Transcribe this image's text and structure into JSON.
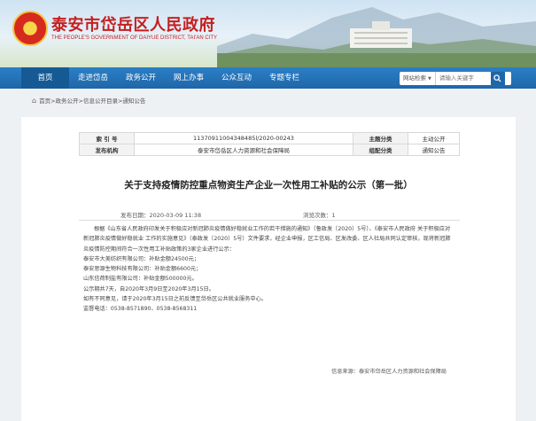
{
  "header": {
    "title": "泰安市岱岳区人民政府",
    "subtitle": "THE PEOPLE'S GOVERNMENT OF DAIYUE DISTRICT, TAI'AN CITY"
  },
  "nav": {
    "items": [
      "首页",
      "走进岱岳",
      "政务公开",
      "网上办事",
      "公众互动",
      "专题专栏"
    ],
    "active_index": 0
  },
  "search": {
    "category": "网站检索",
    "placeholder": "请输入关键字"
  },
  "breadcrumb": "首页>政务公开>信息公开目录>通知公告",
  "meta_table": {
    "index_label": "索 引 号",
    "index_value": "11370911004348485l/2020-00243",
    "category_label": "主题分类",
    "category_value": "主动公开",
    "publisher_label": "发布机构",
    "publisher_value": "泰安市岱岳区人力资源和社会保障局",
    "genre_label": "组配分类",
    "genre_value": "通知公告"
  },
  "article": {
    "title": "关于支持疫情防控重点物资生产企业一次性用工补贴的公示（第一批）",
    "publish_time": "发布日期：2020-03-09 11:38",
    "views": "浏览次数：1",
    "paragraphs": [
      "根据《山东省人民政府印发关于积极应对新冠肺炎疫情做好稳就业工作的若干措施的通知》（鲁政发〔2020〕5号）、《泰安市人民政府 关于积极应对新冠肺炎疫情做好稳就业 工作的实施意见》（泰政发〔2020〕5号）文件要求，经企业申报，区工信局、区发改委、区人社局共同认定审核，现将新冠肺炎疫情防控期间符合一次性用工补贴政策的3家企业进行公示：",
      "泰安市大美纺织有限公司：补贴金额24500元；",
      "泰安思源生物科技有限公司：补贴金额6600元；",
      "山东信荷制盐有限公司：补贴金额500000元。",
      "公示期共7天，自2020年3月9日至2020年3月15日。",
      "如有不同意见，请于2020年3月15日之前反馈至岱岳区公共就业服务中心。",
      "监督电话：0538-8571890、0538-8568311"
    ],
    "source": "信息来源：泰安市岱岳区人力资源和社会保障局"
  }
}
